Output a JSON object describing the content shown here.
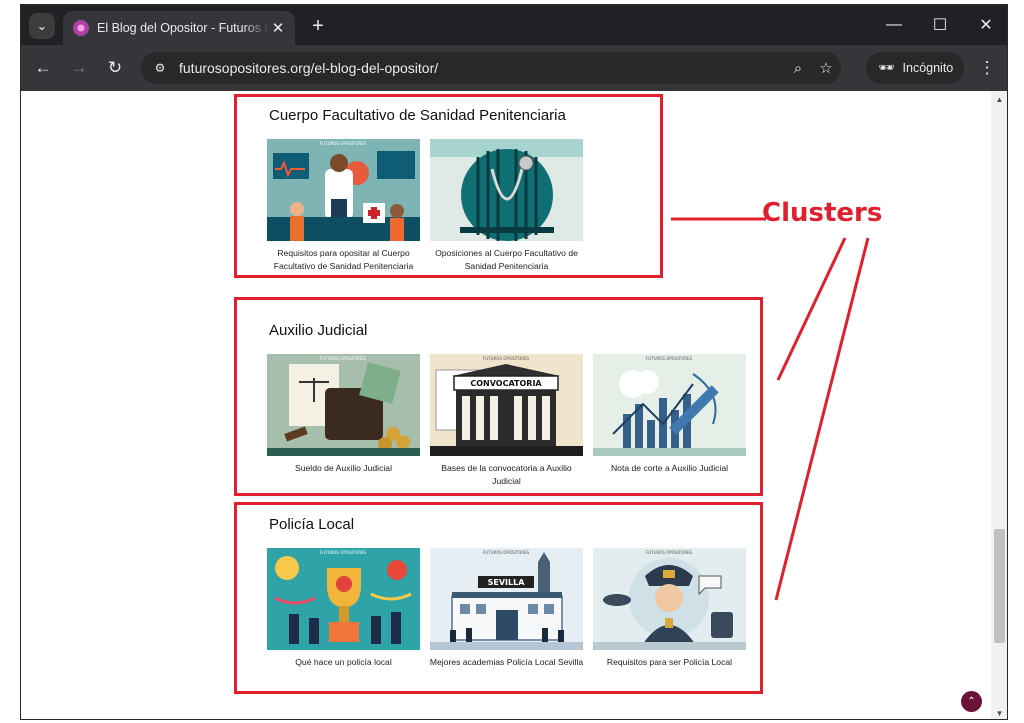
{
  "browser": {
    "tab_title": "El Blog del Opositor - Futuros O",
    "url": "futurosopositores.org/el-blog-del-opositor/",
    "incognito_label": "Incógnito"
  },
  "sections": [
    {
      "title": "Cuerpo Facultativo de Sanidad Penitenciaria",
      "cards": [
        {
          "caption": "Requisitos para opositar al Cuerpo Facultativo de Sanidad Penitenciaria",
          "image_watermark": "FUTUROS OPOSITORES"
        },
        {
          "caption": "Oposiciones al Cuerpo Facultativo de Sanidad Penitenciaria",
          "image_watermark": ""
        }
      ]
    },
    {
      "title": "Auxilio Judicial",
      "cards": [
        {
          "caption": "Sueldo de Auxilio Judicial",
          "image_watermark": "FUTUROS OPOSITORES"
        },
        {
          "caption": "Bases de la convocatoria a Auxilio Judicial",
          "image_watermark": "FUTUROS OPOSITORES",
          "image_text": "CONVOCATORIA"
        },
        {
          "caption": "Nota de corte a Auxilio Judicial",
          "image_watermark": "FUTUROS OPOSITORES"
        }
      ]
    },
    {
      "title": "Policía Local",
      "cards": [
        {
          "caption": "Qué hace un policía local",
          "image_watermark": "FUTUROS OPOSITORES"
        },
        {
          "caption": "Mejores academias Policía Local Sevilla",
          "image_watermark": "FUTUROS OPOSITORES",
          "image_text": "SEVILLA"
        },
        {
          "caption": "Requisitos para ser Policía Local",
          "image_watermark": "FUTUROS OPOSITORES"
        }
      ]
    }
  ],
  "annotation": {
    "label": "Clusters",
    "color": "#e0202e"
  },
  "icons": {
    "tab_search": "chevron-down-icon",
    "favicon": "site-favicon-icon",
    "new_tab": "plus-icon",
    "back": "arrow-left-icon",
    "forward": "arrow-right-icon",
    "reload": "reload-icon",
    "site_info": "tune-icon",
    "zoom": "zoom-icon",
    "bookmark": "star-icon",
    "incognito": "incognito-icon",
    "menu": "kebab-menu-icon",
    "scroll_top": "chevron-up-icon"
  }
}
